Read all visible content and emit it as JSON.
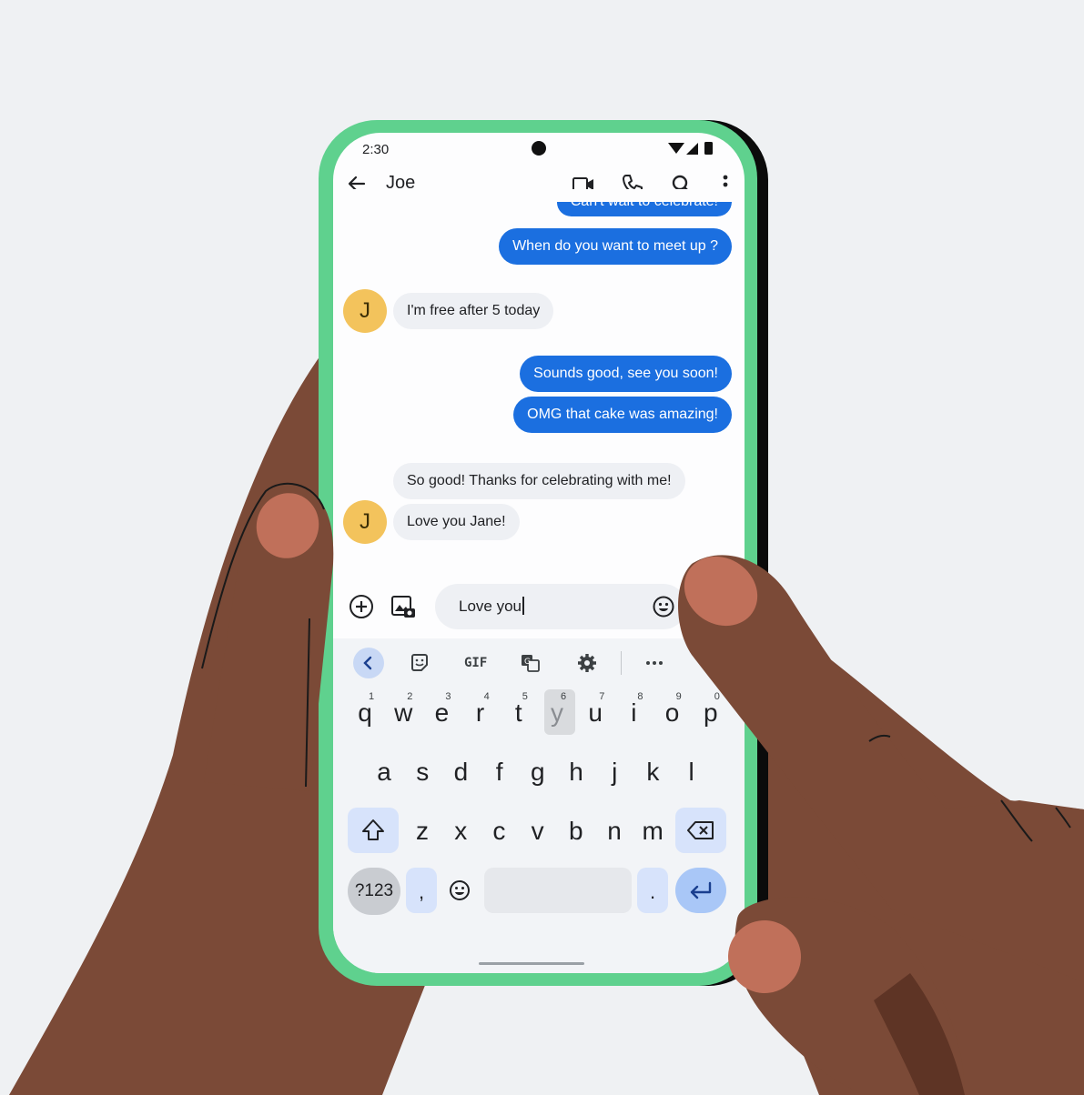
{
  "status_bar": {
    "time": "2:30"
  },
  "header": {
    "contact_name": "Joe"
  },
  "messages": [
    {
      "direction": "sent",
      "text": "Can't wait to celebrate!"
    },
    {
      "direction": "sent",
      "text": "When do you want to meet up ?"
    },
    {
      "direction": "received",
      "avatar": "J",
      "text": "I'm free after 5 today"
    },
    {
      "direction": "sent",
      "text": "Sounds good, see you soon!"
    },
    {
      "direction": "sent",
      "text": "OMG that cake was amazing!"
    },
    {
      "direction": "received",
      "text": "So good! Thanks for celebrating with me!"
    },
    {
      "direction": "received",
      "avatar": "J",
      "text": "Love you Jane!"
    }
  ],
  "compose": {
    "value": "Love you"
  },
  "keyboard": {
    "toolbar": {
      "gif_label": "GIF"
    },
    "row1": [
      "q",
      "w",
      "e",
      "r",
      "t",
      "y",
      "u",
      "i",
      "o",
      "p"
    ],
    "row1_hints": [
      "1",
      "2",
      "3",
      "4",
      "5",
      "6",
      "7",
      "8",
      "9",
      "0"
    ],
    "row2": [
      "a",
      "s",
      "d",
      "f",
      "g",
      "h",
      "j",
      "k",
      "l"
    ],
    "row3": [
      "z",
      "x",
      "c",
      "v",
      "b",
      "n",
      "m"
    ],
    "symbols_label": "?123",
    "comma": ",",
    "period": ".",
    "pressed_key": "y"
  },
  "colors": {
    "phone_frame": "#5fd18e",
    "sent_bubble": "#1b6fe0",
    "received_bubble": "#eef0f4",
    "avatar": "#f3c35c",
    "skin": "#7b4a37",
    "nail": "#c0705a"
  },
  "icons": [
    "back-arrow-icon",
    "video-call-icon",
    "phone-icon",
    "search-icon",
    "more-vert-icon",
    "add-icon",
    "gallery-icon",
    "emoji-icon",
    "sticker-icon",
    "translate-icon",
    "settings-icon",
    "more-horiz-icon",
    "mic-icon",
    "shift-icon",
    "backspace-icon",
    "enter-icon"
  ]
}
